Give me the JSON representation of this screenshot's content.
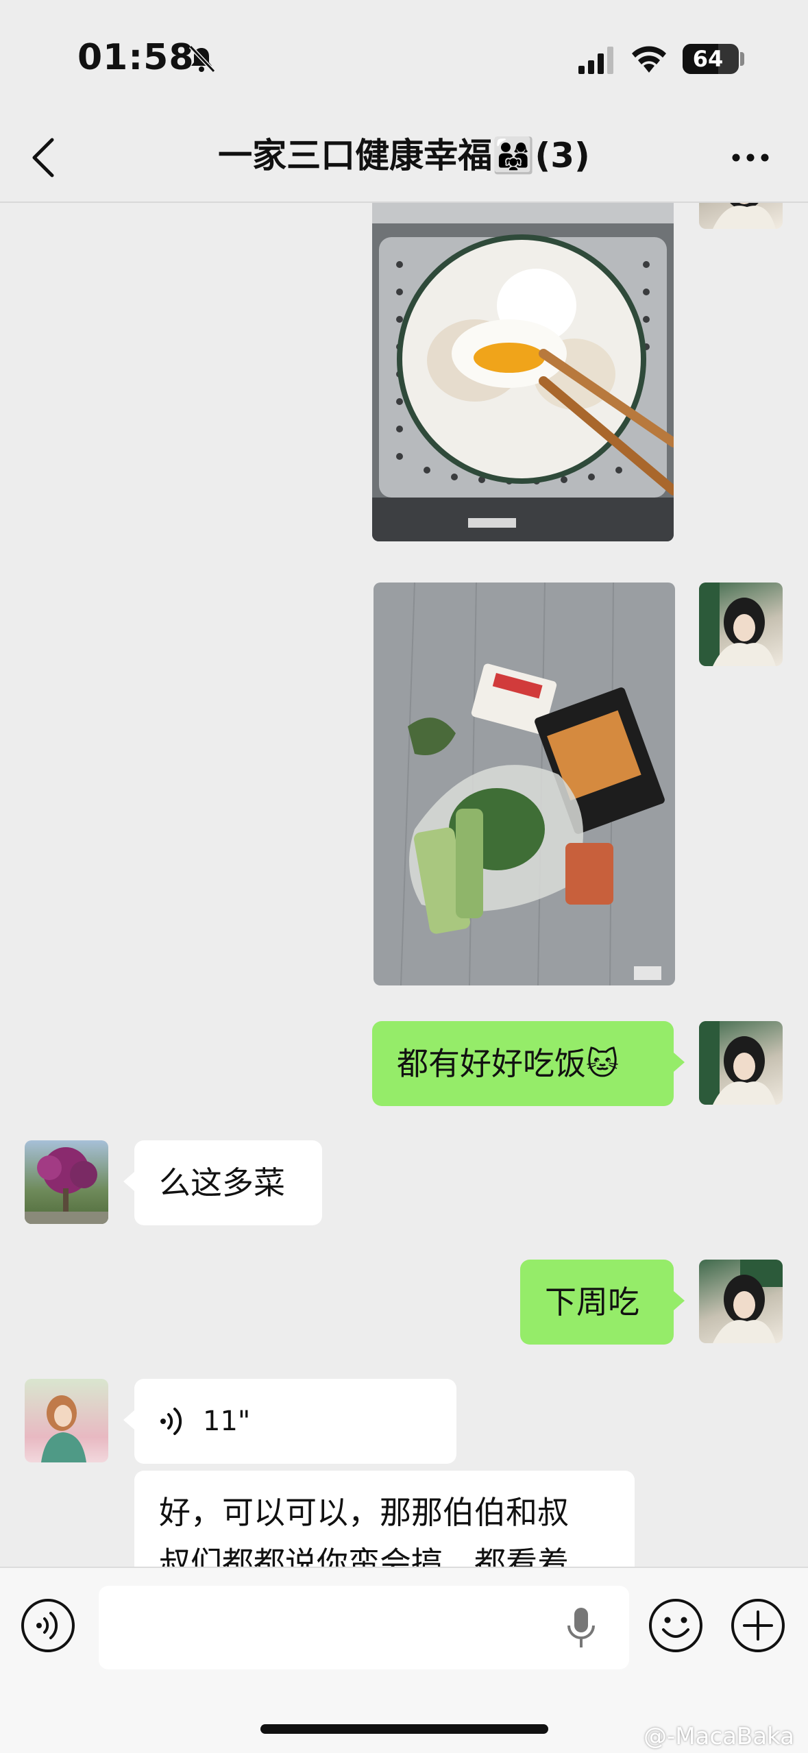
{
  "status_bar": {
    "time": "01:58",
    "battery_percent": 64,
    "battery_label": "64",
    "icons": [
      "bell-slash-icon",
      "signal-icon",
      "wifi-icon",
      "battery-icon"
    ]
  },
  "nav": {
    "title": "一家三口健康幸福👨‍👩‍👧(3)",
    "back_icon": "chevron-left-icon",
    "more_icon": "more-icon"
  },
  "messages": {
    "text_have_meals": "都有好好吃饭🐱",
    "text_so_many_dishes": "么这多菜",
    "text_next_week": "下周吃",
    "voice_duration": "11\"",
    "text_long_line1": "好，可以可以，那那伯伯和叔",
    "text_long_line2": "叔们都都说你蛮会搞，都看着"
  },
  "input_bar": {
    "voice_icon": "voice-mode-icon",
    "mic_icon": "microphone-icon",
    "emoji_icon": "emoji-icon",
    "plus_icon": "plus-icon"
  },
  "watermark": "@-MacaBaka",
  "colors": {
    "background": "#ededed",
    "my_bubble": "#95ec69",
    "their_bubble": "#ffffff"
  }
}
